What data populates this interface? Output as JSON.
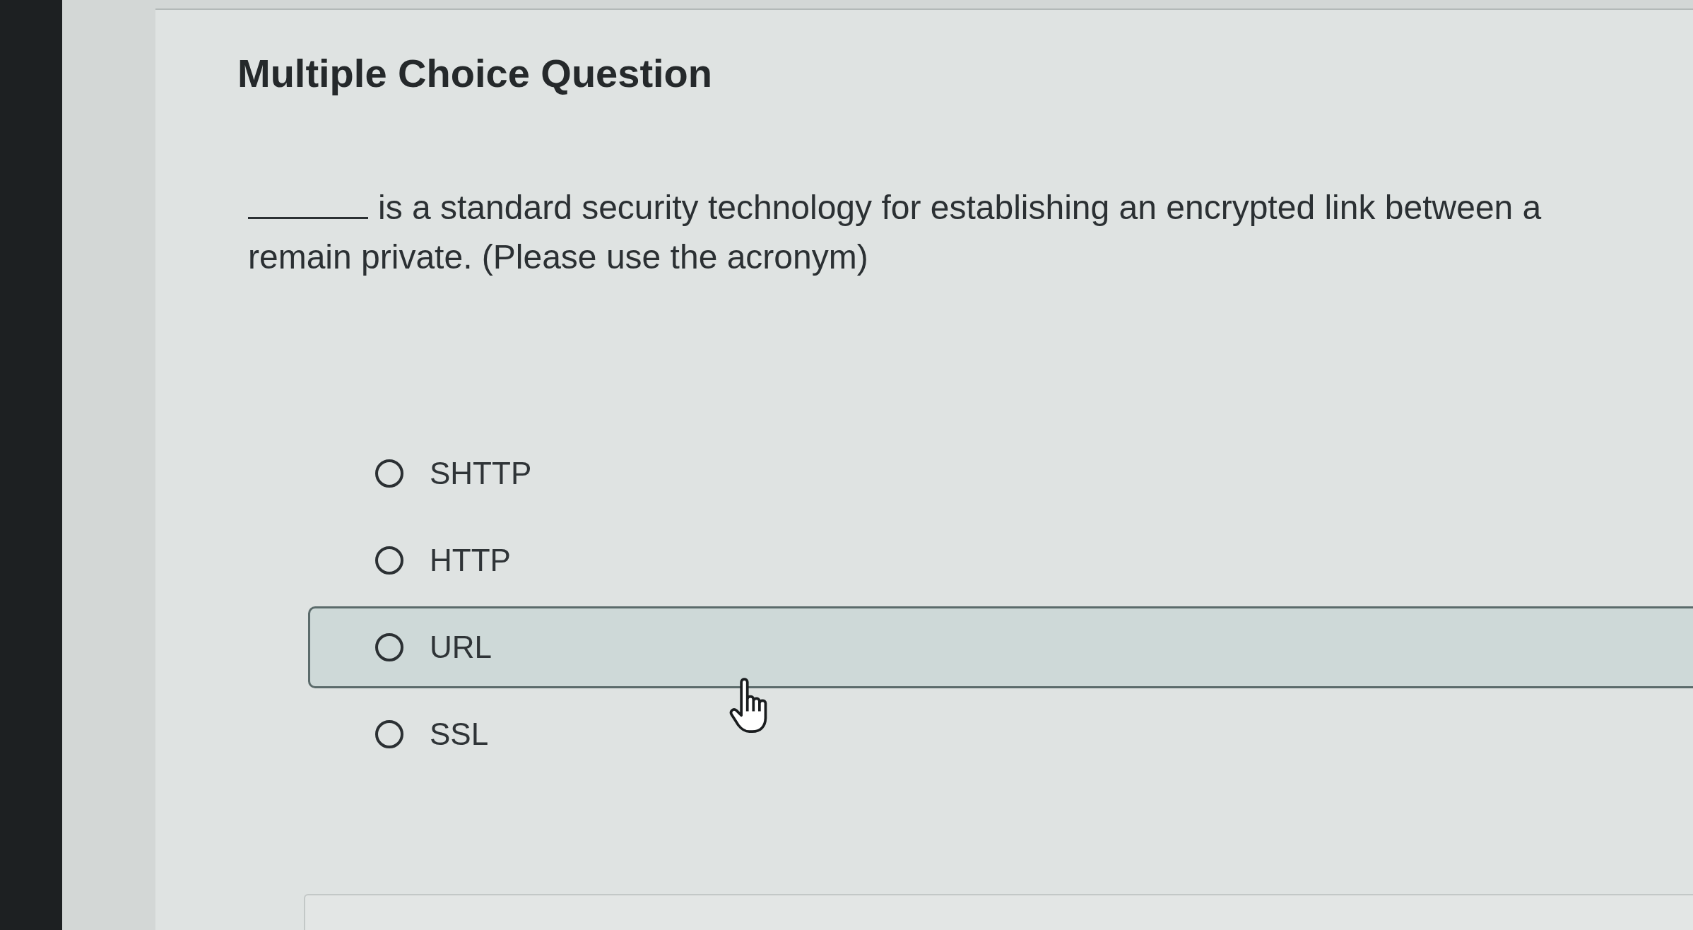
{
  "title": "Multiple Choice Question",
  "question": {
    "lines": [
      {
        "parts": [
          {
            "kind": "blank"
          },
          {
            "kind": "text",
            "text": "is a standard security technology for establishing an encrypted link between a"
          }
        ]
      },
      {
        "parts": [
          {
            "kind": "text",
            "text": "remain private. (Please use the acronym)"
          }
        ]
      }
    ]
  },
  "options": [
    {
      "label": "SHTTP",
      "selected": false,
      "hovered": false
    },
    {
      "label": "HTTP",
      "selected": false,
      "hovered": false
    },
    {
      "label": "URL",
      "selected": false,
      "hovered": true
    },
    {
      "label": "SSL",
      "selected": false,
      "hovered": false
    }
  ]
}
